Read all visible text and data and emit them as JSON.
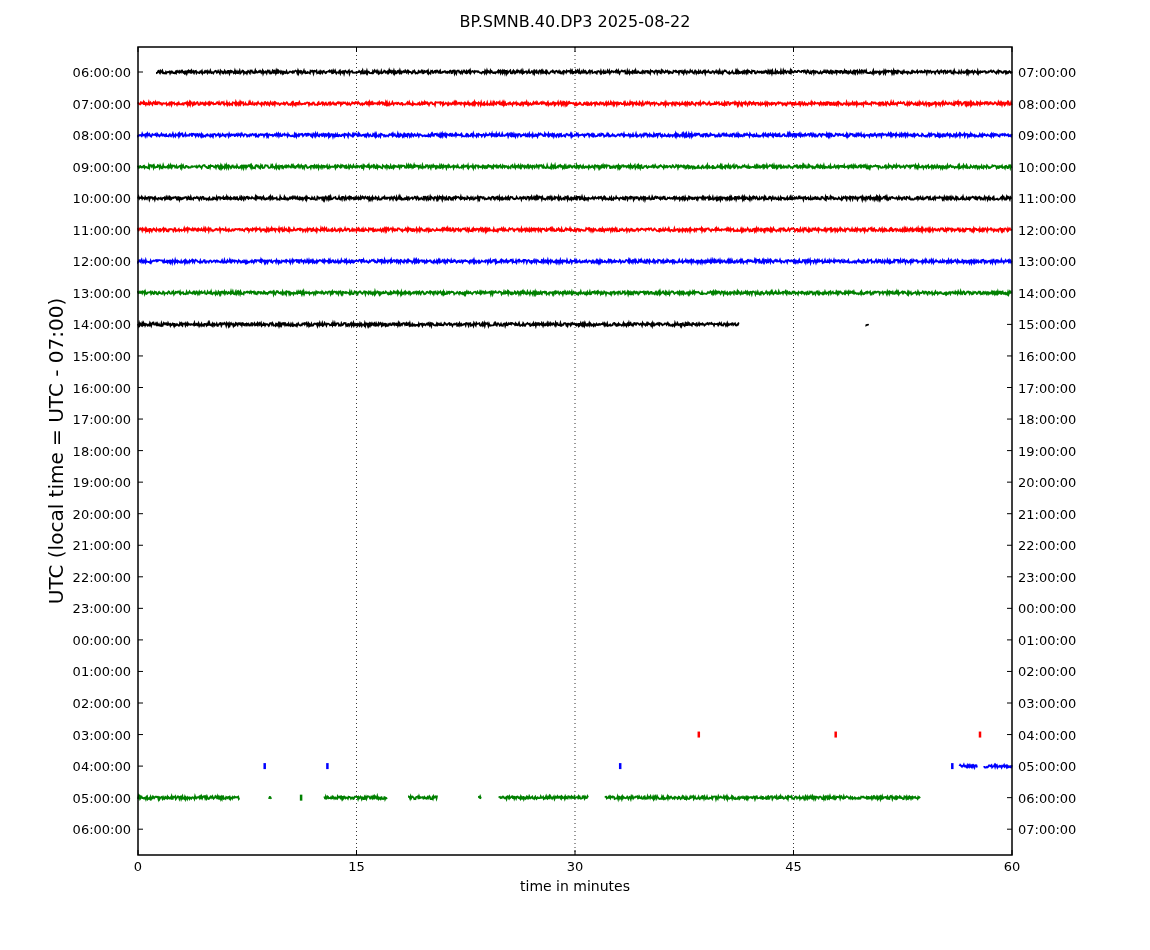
{
  "title": "BP.SMNB.40.DP3 2025-08-22",
  "ylabel": "UTC (local time = UTC - 07:00)",
  "xlabel": "time in minutes",
  "xticks": [
    "0",
    "15",
    "30",
    "45",
    "60"
  ],
  "rows": [
    {
      "left": "06:00:00",
      "right": "07:00:00",
      "color": "#000000"
    },
    {
      "left": "07:00:00",
      "right": "08:00:00",
      "color": "#ff0000"
    },
    {
      "left": "08:00:00",
      "right": "09:00:00",
      "color": "#0000ff"
    },
    {
      "left": "09:00:00",
      "right": "10:00:00",
      "color": "#008000"
    },
    {
      "left": "10:00:00",
      "right": "11:00:00",
      "color": "#000000"
    },
    {
      "left": "11:00:00",
      "right": "12:00:00",
      "color": "#ff0000"
    },
    {
      "left": "12:00:00",
      "right": "13:00:00",
      "color": "#0000ff"
    },
    {
      "left": "13:00:00",
      "right": "14:00:00",
      "color": "#008000"
    },
    {
      "left": "14:00:00",
      "right": "15:00:00",
      "color": "#000000"
    },
    {
      "left": "15:00:00",
      "right": "16:00:00"
    },
    {
      "left": "16:00:00",
      "right": "17:00:00"
    },
    {
      "left": "17:00:00",
      "right": "18:00:00"
    },
    {
      "left": "18:00:00",
      "right": "19:00:00"
    },
    {
      "left": "19:00:00",
      "right": "20:00:00"
    },
    {
      "left": "20:00:00",
      "right": "21:00:00"
    },
    {
      "left": "21:00:00",
      "right": "22:00:00"
    },
    {
      "left": "22:00:00",
      "right": "23:00:00"
    },
    {
      "left": "23:00:00",
      "right": "00:00:00"
    },
    {
      "left": "00:00:00",
      "right": "01:00:00"
    },
    {
      "left": "01:00:00",
      "right": "02:00:00"
    },
    {
      "left": "02:00:00",
      "right": "03:00:00"
    },
    {
      "left": "03:00:00",
      "right": "04:00:00",
      "color": "#ff0000"
    },
    {
      "left": "04:00:00",
      "right": "05:00:00",
      "color": "#0000ff"
    },
    {
      "left": "05:00:00",
      "right": "06:00:00",
      "color": "#008000"
    },
    {
      "left": "06:00:00",
      "right": "07:00:00"
    }
  ]
}
